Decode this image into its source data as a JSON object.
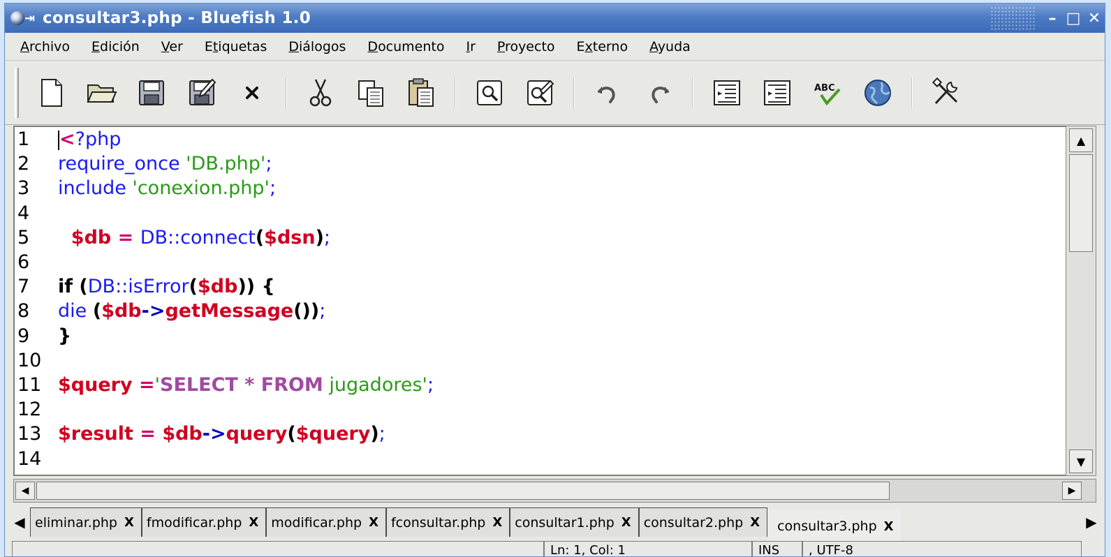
{
  "window": {
    "title": "consultar3.php - Bluefish 1.0",
    "controls": {
      "minimize": "–",
      "maximize": "□",
      "close": "✕"
    }
  },
  "menubar": {
    "items": [
      {
        "label": "Archivo",
        "mnemonic": "A"
      },
      {
        "label": "Edición",
        "mnemonic": "E"
      },
      {
        "label": "Ver",
        "mnemonic": "V"
      },
      {
        "label": "Etiquetas",
        "mnemonic": "t"
      },
      {
        "label": "Diálogos",
        "mnemonic": "D"
      },
      {
        "label": "Documento",
        "mnemonic": "D"
      },
      {
        "label": "Ir",
        "mnemonic": "I"
      },
      {
        "label": "Proyecto",
        "mnemonic": "P"
      },
      {
        "label": "Externo",
        "mnemonic": "x"
      },
      {
        "label": "Ayuda",
        "mnemonic": "A"
      }
    ]
  },
  "toolbar": {
    "buttons": [
      "new-document-icon",
      "open-folder-icon",
      "save-icon",
      "save-as-icon",
      "close-x-icon",
      "cut-icon",
      "copy-icon",
      "paste-icon",
      "find-icon",
      "replace-icon",
      "undo-icon",
      "redo-icon",
      "unindent-icon",
      "indent-icon",
      "spellcheck-icon",
      "browser-preview-icon",
      "preferences-tools-icon"
    ]
  },
  "editor": {
    "lines": [
      {
        "n": "1",
        "tokens": [
          {
            "t": "<",
            "c": "c-magenta"
          },
          {
            "t": "?php",
            "c": "c-blue"
          }
        ]
      },
      {
        "n": "2",
        "tokens": [
          {
            "t": "require_once ",
            "c": "c-blue"
          },
          {
            "t": "'DB.php'",
            "c": "c-green"
          },
          {
            "t": ";",
            "c": "c-blue"
          }
        ]
      },
      {
        "n": "3",
        "tokens": [
          {
            "t": "include ",
            "c": "c-blue"
          },
          {
            "t": "'conexion.php'",
            "c": "c-green"
          },
          {
            "t": ";",
            "c": "c-blue"
          }
        ]
      },
      {
        "n": "4",
        "tokens": []
      },
      {
        "n": "5",
        "tokens": [
          {
            "t": "  $db",
            "c": "c-red"
          },
          {
            "t": " = ",
            "c": "c-magenta"
          },
          {
            "t": "DB::connect",
            "c": "c-blue"
          },
          {
            "t": "(",
            "c": "c-black"
          },
          {
            "t": "$dsn",
            "c": "c-red"
          },
          {
            "t": ")",
            "c": "c-black"
          },
          {
            "t": ";",
            "c": "c-blue"
          }
        ]
      },
      {
        "n": "6",
        "tokens": []
      },
      {
        "n": "7",
        "tokens": [
          {
            "t": "if (",
            "c": "c-black"
          },
          {
            "t": "DB::isError",
            "c": "c-blue"
          },
          {
            "t": "(",
            "c": "c-black"
          },
          {
            "t": "$db",
            "c": "c-red"
          },
          {
            "t": ")) {",
            "c": "c-black"
          }
        ]
      },
      {
        "n": "8",
        "tokens": [
          {
            "t": "die ",
            "c": "c-blue"
          },
          {
            "t": "(",
            "c": "c-black"
          },
          {
            "t": "$db",
            "c": "c-red"
          },
          {
            "t": "->",
            "c": "c-darkblue"
          },
          {
            "t": "getMessage",
            "c": "c-red"
          },
          {
            "t": "())",
            "c": "c-black"
          },
          {
            "t": ";",
            "c": "c-blue"
          }
        ]
      },
      {
        "n": "9",
        "tokens": [
          {
            "t": "}",
            "c": "c-black"
          }
        ]
      },
      {
        "n": "10",
        "tokens": []
      },
      {
        "n": "11",
        "tokens": [
          {
            "t": "$query",
            "c": "c-red"
          },
          {
            "t": " =",
            "c": "c-magenta"
          },
          {
            "t": "'",
            "c": "c-green"
          },
          {
            "t": "SELECT * FROM",
            "c": "c-purple"
          },
          {
            "t": " jugadores'",
            "c": "c-green"
          },
          {
            "t": ";",
            "c": "c-blue"
          }
        ]
      },
      {
        "n": "12",
        "tokens": []
      },
      {
        "n": "13",
        "tokens": [
          {
            "t": "$result",
            "c": "c-red"
          },
          {
            "t": " = ",
            "c": "c-magenta"
          },
          {
            "t": "$db",
            "c": "c-red"
          },
          {
            "t": "->",
            "c": "c-darkblue"
          },
          {
            "t": "query",
            "c": "c-red"
          },
          {
            "t": "(",
            "c": "c-black"
          },
          {
            "t": "$query",
            "c": "c-red"
          },
          {
            "t": ")",
            "c": "c-black"
          },
          {
            "t": ";",
            "c": "c-blue"
          }
        ]
      },
      {
        "n": "14",
        "tokens": []
      }
    ]
  },
  "tabs": {
    "items": [
      {
        "label": "eliminar.php",
        "active": false
      },
      {
        "label": "fmodificar.php",
        "active": false
      },
      {
        "label": "modificar.php",
        "active": false
      },
      {
        "label": "fconsultar.php",
        "active": false
      },
      {
        "label": "consultar1.php",
        "active": false
      },
      {
        "label": "consultar2.php",
        "active": false
      },
      {
        "label": "consultar3.php",
        "active": true
      }
    ],
    "close_label": "X"
  },
  "statusbar": {
    "cells": [
      "",
      "Ln: 1, Col: 1",
      "INS",
      "  ,  UTF-8"
    ]
  }
}
